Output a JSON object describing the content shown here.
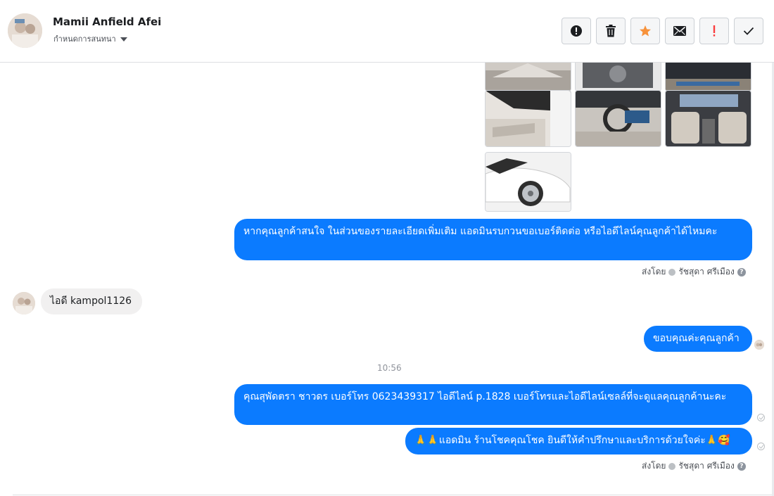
{
  "header": {
    "contact_name": "Mamii Anfield Afei",
    "assign_label": "กำหนดการสนทนา",
    "actions": [
      {
        "name": "mark-spam",
        "icon": "alert-circle-icon"
      },
      {
        "name": "delete",
        "icon": "trash-icon"
      },
      {
        "name": "star",
        "icon": "star-icon",
        "color": "#f7923b"
      },
      {
        "name": "mark-unread",
        "icon": "envelope-icon"
      },
      {
        "name": "follow-up",
        "icon": "exclamation-icon",
        "color": "#fa3e3e"
      },
      {
        "name": "done",
        "icon": "check-icon"
      }
    ]
  },
  "messages": {
    "m1_text": "หากคุณลูกค้าสนใจ ในส่วนของรายละเอียดเพิ่มเติม แอดมินรบกวนขอเบอร์ติดต่อ หรือไอดีไลน์คุณลูกค้าได้ไหมคะ",
    "sent_by_label": "ส่งโดย",
    "sender_name": "รัชสุดา ศรีเมือง",
    "in_text": "ไอดี kampol1126",
    "m2_text": "ขอบคุณค่ะคุณลูกค้า",
    "time": "10:56",
    "m3_text": "คุณสุพัดตรา   ชาวดร      เบอร์โทร 0623439317  ไอดีไลน์ p.1828   เบอร์โทรและไอดีไลน์เซลล์ที่จะดูแลคุณลูกค้านะคะ",
    "m4_text": "🙏🙏แอดมิน ร้านโชคคุณโชค ยินดีให้คำปรึกษาและบริการด้วยใจค่ะ🙏🥰"
  },
  "colors": {
    "outgoing_bubble": "#0b7bff",
    "incoming_bubble": "#f1f0f0"
  }
}
